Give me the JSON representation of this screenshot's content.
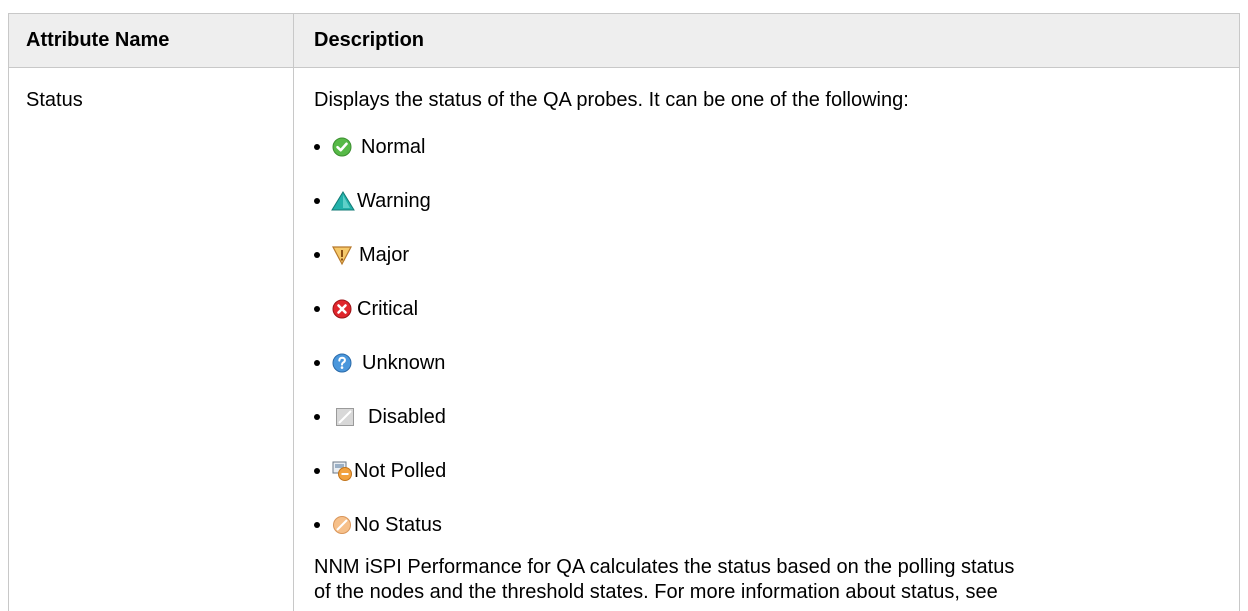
{
  "table": {
    "headers": {
      "name": "Attribute Name",
      "description": "Description"
    },
    "row": {
      "name": "Status",
      "intro": "Displays the status of the QA probes. It can be one of the following:",
      "items": [
        {
          "label": "Normal",
          "icon": "normal-status-icon",
          "color": "#4cae3c"
        },
        {
          "label": "Warning",
          "icon": "warning-status-icon",
          "color": "#1fa7a0"
        },
        {
          "label": "Major",
          "icon": "major-status-icon",
          "color": "#e0a23a"
        },
        {
          "label": "Critical",
          "icon": "critical-status-icon",
          "color": "#d3262b"
        },
        {
          "label": "Unknown",
          "icon": "unknown-status-icon",
          "color": "#3f8fd6"
        },
        {
          "label": "Disabled",
          "icon": "disabled-status-icon",
          "color": "#b9b9b9"
        },
        {
          "label": "Not Polled",
          "icon": "not-polled-status-icon",
          "color": "#f0a040"
        },
        {
          "label": "No Status",
          "icon": "no-status-icon",
          "color": "#f1b37a"
        }
      ],
      "footer_line1": "NNM iSPI Performance for QA calculates the status based on the polling status",
      "footer_line2": "of the nodes and the threshold states. For more information about status, see"
    }
  }
}
